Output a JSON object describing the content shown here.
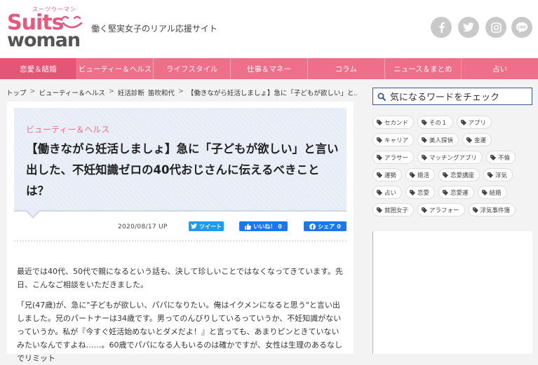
{
  "header": {
    "logo_kana": "スーツウーマン",
    "logo_suits": "Suits",
    "logo_woman": "woman",
    "tagline": "働く堅実女子のリアル応援サイト",
    "social": [
      "facebook-icon",
      "twitter-icon",
      "instagram-icon",
      "line-icon"
    ],
    "line_label": "LINE"
  },
  "nav": {
    "items": [
      {
        "label": "恋愛＆結婚"
      },
      {
        "label": "ビューティー＆ヘルス"
      },
      {
        "label": "ライフスタイル"
      },
      {
        "label": "仕事＆マネー"
      },
      {
        "label": "コラム"
      },
      {
        "label": "ニュース＆まとめ"
      },
      {
        "label": "占い"
      }
    ],
    "active_color": "#e35676",
    "bar_color": "#ef6f8b"
  },
  "breadcrumb": {
    "items": [
      "トップ",
      "ビューティー＆ヘルス",
      "妊活診断",
      "笛吹和代",
      "【働きながら妊活しましょ】急に「子どもが欲しい」と..."
    ],
    "separator": ">"
  },
  "article": {
    "category": "ビューティー＆ヘルス",
    "title": "【働きながら妊活しましょ】急に「子どもが欲しい」と言い出した、不妊知識ゼロの40代おじさんに伝えるべきことは？",
    "date": "2020/08/17",
    "date_suffix": "UP",
    "tweet_label": "ツイート",
    "like_label": "いいね！",
    "like_count": "0",
    "share_label": "シェア",
    "share_count": "0",
    "paragraph1": "最近では40代、50代で親になるという話も、決して珍しいことではなくなってきています。先日、こんなご相談をいただきました。",
    "paragraph2": "「兄(47歳)が、急に\"子どもが欲しい、パパになりたい。俺はイクメンになると思う\"と言い出しました。兄のパートナーは34歳です。男ってのんびりしているっていうか、不妊知識がないっていうか。私が『今すぐ妊活始めないとダメだよ！』と言っても、あまりピンときていないみたいなんですよね……。60歳でパパになる人もいるのは確かですが、女性は生理のあるなしでリミット"
  },
  "sidebar": {
    "search_placeholder": "気になるワードをチェック",
    "tags": [
      "セカンド",
      "その１",
      "アプリ",
      "キャリア",
      "美人探偵",
      "金運",
      "アラサー",
      "マッチングアプリ",
      "不倫",
      "運勢",
      "婚活",
      "恋愛講座",
      "浮気",
      "占い",
      "恋愛",
      "恋愛運",
      "結婚",
      "貧困女子",
      "アラフォー",
      "浮気事件簿"
    ]
  },
  "colors": {
    "brand_pink": "#e8577e",
    "tweet_blue": "#1d9bf0",
    "facebook_blue": "#1877f2",
    "search_border": "#3a5a8c"
  }
}
